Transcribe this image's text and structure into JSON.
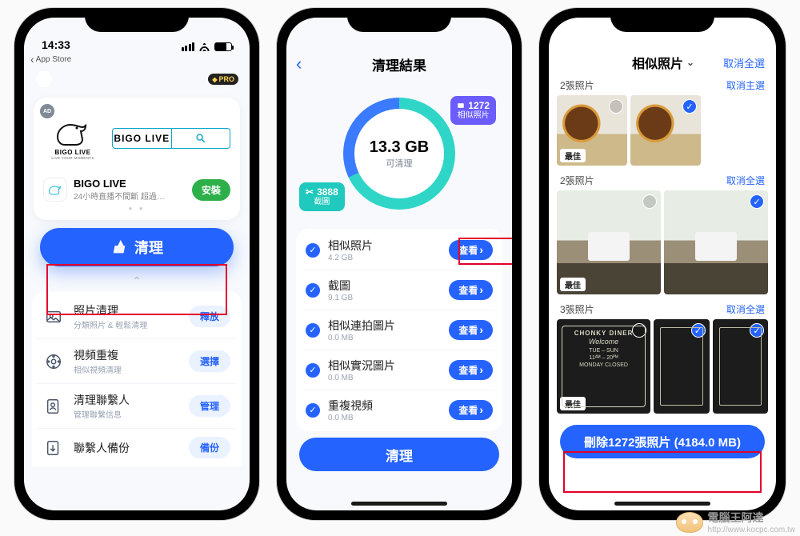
{
  "screen1": {
    "time": "14:33",
    "crumb": "App Store",
    "ad": {
      "tag": "AD",
      "brand": "BIGO LIVE",
      "brand_tag": "LIVE YOUR MOMENTS",
      "search_text": "BIGO LIVE",
      "app_name": "BIGO LIVE",
      "app_sub": "24小時直播不間斷 超過…",
      "install": "安裝"
    },
    "clean_btn": "清理",
    "menu": [
      {
        "title": "照片清理",
        "sub": "分類照片 & 輕鬆清理",
        "action": "釋放"
      },
      {
        "title": "視頻重複",
        "sub": "相似視頻清理",
        "action": "選擇"
      },
      {
        "title": "清理聯繫人",
        "sub": "管理聯繫信息",
        "action": "管理"
      },
      {
        "title": "聯繫人備份",
        "sub": "",
        "action": "備份"
      }
    ]
  },
  "screen2": {
    "title": "清理結果",
    "center_value": "13.3 GB",
    "center_label": "可清理",
    "tag_tr_count": "1272",
    "tag_tr_label": "相似照片",
    "tag_bl_count": "3888",
    "tag_bl_label": "截圖",
    "items": [
      {
        "name": "相似照片",
        "size": "4.2 GB",
        "btn": "查看"
      },
      {
        "name": "截圖",
        "size": "9.1 GB",
        "btn": "查看"
      },
      {
        "name": "相似連拍圖片",
        "size": "0.0 MB",
        "btn": "查看"
      },
      {
        "name": "相似實況圖片",
        "size": "0.0 MB",
        "btn": "查看"
      },
      {
        "name": "重複視頻",
        "size": "0.0 MB",
        "btn": "查看"
      }
    ],
    "clean_btn": "清理"
  },
  "screen3": {
    "title": "相似照片",
    "deselect_all": "取消全選",
    "groups": [
      {
        "count_label": "2張照片",
        "action": "取消主選",
        "best": "最佳"
      },
      {
        "count_label": "2張照片",
        "action": "取消全選",
        "best": "最佳"
      },
      {
        "count_label": "3張照片",
        "action": "取消全選",
        "best": "最佳"
      }
    ],
    "diner_sign": {
      "top": "CHONKY DINER",
      "mid": "Welcome",
      "days": "TUE – SUN",
      "hours": "11ᴬᴹ – 20ᴾᴹ",
      "closed": "MONDAY CLOSED"
    },
    "delete_btn": "刪除1272張照片 (4184.0 MB)"
  },
  "watermark": {
    "cn": "電腦王阿達",
    "url": "http://www.kocpc.com.tw"
  }
}
